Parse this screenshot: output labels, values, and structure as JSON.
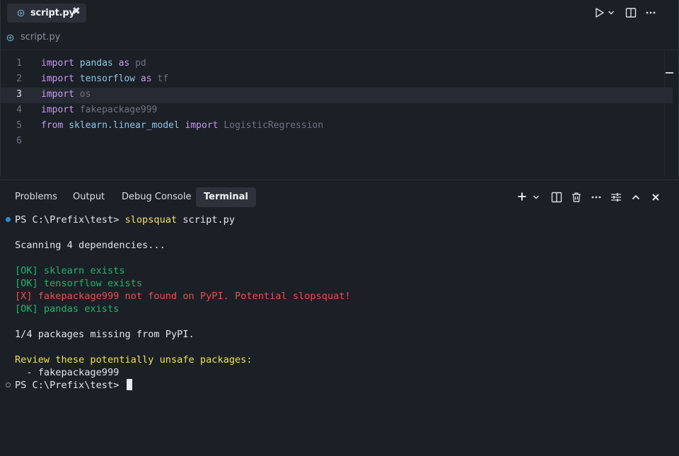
{
  "colors": {
    "background": "#1b1f26",
    "keyword": "#c79af0",
    "module": "#8ec7e6",
    "ok_green": "#21b56b",
    "error_red": "#e8504b",
    "warning_yellow": "#efe14f",
    "status_dot_blue": "#2f8ccb"
  },
  "editor": {
    "tab": {
      "label": "script.py",
      "close_glyph": "✖",
      "icon": "python-file-icon"
    },
    "breadcrumb": {
      "label": "script.py",
      "icon": "python-file-icon"
    },
    "actions": [
      "run-icon",
      "chevron-down-icon",
      "split-editor-icon",
      "more-icon"
    ],
    "lines": [
      {
        "num": "1",
        "tokens": [
          [
            "kw",
            "import"
          ],
          [
            "sp",
            " "
          ],
          [
            "mod",
            "pandas"
          ],
          [
            "sp",
            " "
          ],
          [
            "kw",
            "as"
          ],
          [
            "sp",
            " "
          ],
          [
            "alias",
            "pd"
          ]
        ]
      },
      {
        "num": "2",
        "tokens": [
          [
            "kw",
            "import"
          ],
          [
            "sp",
            " "
          ],
          [
            "mod",
            "tensorflow"
          ],
          [
            "sp",
            " "
          ],
          [
            "kw",
            "as"
          ],
          [
            "sp",
            " "
          ],
          [
            "alias",
            "tf"
          ]
        ]
      },
      {
        "num": "3",
        "tokens": [
          [
            "kw",
            "import"
          ],
          [
            "sp",
            " "
          ],
          [
            "alias",
            "os"
          ]
        ],
        "current": true
      },
      {
        "num": "4",
        "tokens": [
          [
            "kw",
            "import"
          ],
          [
            "sp",
            " "
          ],
          [
            "alias",
            "fakepackage999"
          ]
        ]
      },
      {
        "num": "5",
        "tokens": [
          [
            "kw",
            "from"
          ],
          [
            "sp",
            " "
          ],
          [
            "mod",
            "sklearn.linear_model"
          ],
          [
            "sp",
            " "
          ],
          [
            "kw",
            "import"
          ],
          [
            "sp",
            " "
          ],
          [
            "alias",
            "LogisticRegression"
          ]
        ]
      },
      {
        "num": "6",
        "tokens": []
      }
    ]
  },
  "panel": {
    "tabs": [
      "Problems",
      "Output",
      "Debug Console",
      "Terminal"
    ],
    "active_tab": "Terminal",
    "actions": [
      "add-icon",
      "chevron-down-icon",
      "split-terminal-icon",
      "trash-icon",
      "more-icon",
      "settings-sliders-icon",
      "chevron-up-icon",
      "close-icon"
    ]
  },
  "terminal": {
    "prompt": "PS C:\\Prefix\\test> ",
    "command": "slopsquat",
    "command_arg": " script.py",
    "scanning": "Scanning 4 dependencies...",
    "results": [
      {
        "status": "ok",
        "text": "[OK] sklearn exists"
      },
      {
        "status": "ok",
        "text": "[OK] tensorflow exists"
      },
      {
        "status": "error",
        "text": "[X] fakepackage999 not found on PyPI. Potential slopsquat!"
      },
      {
        "status": "ok",
        "text": "[OK] pandas exists"
      }
    ],
    "summary": "1/4 packages missing from PyPI.",
    "review_heading": "Review these potentially unsafe packages:",
    "review_items": [
      "  - fakepackage999"
    ],
    "final_prompt": "PS C:\\Prefix\\test> "
  }
}
